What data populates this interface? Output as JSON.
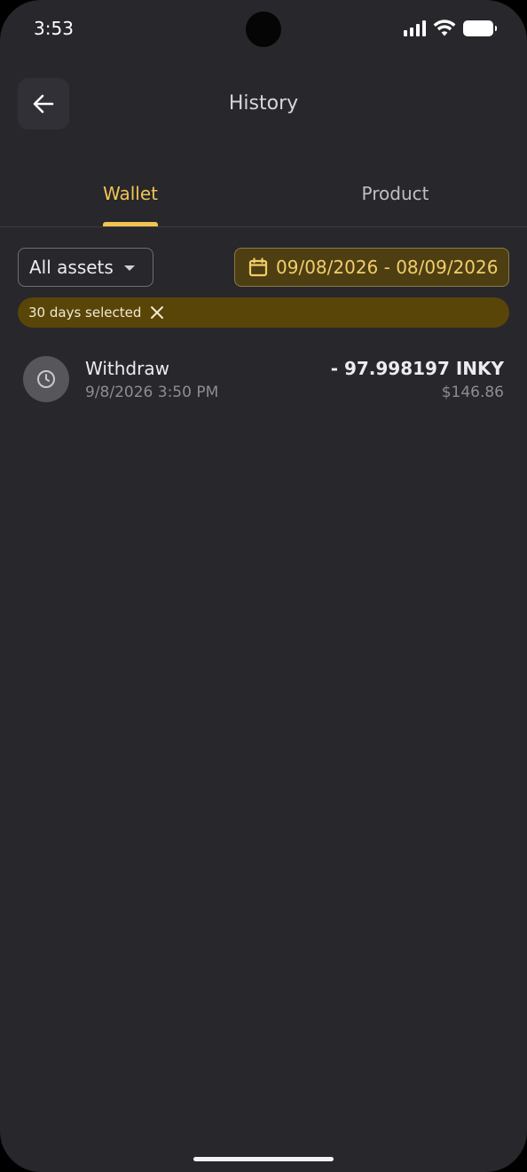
{
  "status_bar": {
    "time": "3:53"
  },
  "header": {
    "title": "History",
    "back_icon": "arrow-left-icon"
  },
  "tabs": [
    {
      "label": "Wallet",
      "active": true
    },
    {
      "label": "Product",
      "active": false
    }
  ],
  "filters": {
    "asset_select": {
      "value": "All assets"
    },
    "date_range": {
      "value": "09/08/2026 - 08/09/2026",
      "icon": "calendar-icon"
    },
    "selection_chip": {
      "label": "30 days selected",
      "icon": "close-icon"
    }
  },
  "transactions": [
    {
      "type": "Withdraw",
      "datetime": "9/8/2026 3:50 PM",
      "amount": "- 97.998197 INKY",
      "fiat_value": "$146.86",
      "icon": "clock-icon"
    }
  ],
  "colors": {
    "background": "#27272c",
    "accent": "#f0c452",
    "chip_background": "#5a4508",
    "date_range_background": "#4e3f12"
  }
}
